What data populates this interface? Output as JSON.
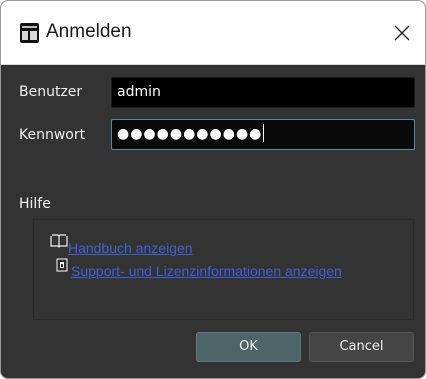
{
  "window": {
    "title": "Anmelden",
    "app_icon": "app-logo-icon",
    "close_icon": "close-icon"
  },
  "form": {
    "user_label": "Benutzer",
    "user_value": "admin",
    "password_label": "Kennwort",
    "password_value": "●●●●●●●●●●●"
  },
  "help": {
    "heading": "Hilfe",
    "links": [
      {
        "label": "Handbuch anzeigen",
        "icon": "book-icon"
      },
      {
        "label": "Support- und Lizenzinformationen anzeigen",
        "icon": "info-document-icon"
      }
    ]
  },
  "buttons": {
    "ok_label": "OK",
    "cancel_label": "Cancel"
  },
  "colors": {
    "dialog_background": "#333333",
    "link": "#4060d8",
    "focus_border": "#4e8fa5",
    "ok_button": "#4d6468"
  }
}
